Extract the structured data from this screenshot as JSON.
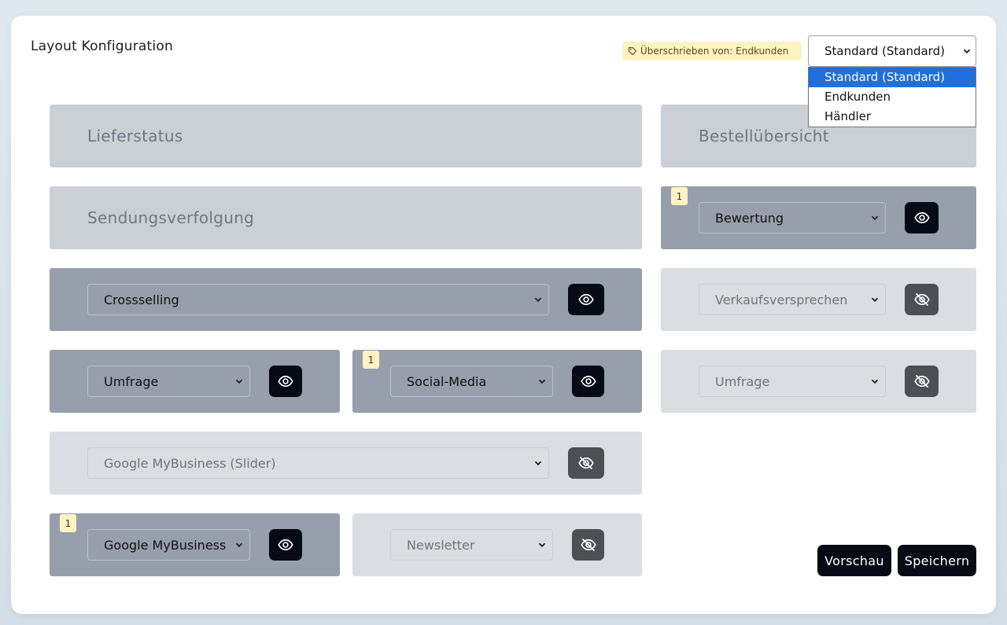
{
  "header": {
    "title": "Layout Konfiguration",
    "override_badge": "Überschrieben von: Endkunden",
    "layout_select": {
      "value": "Standard (Standard)",
      "options": [
        "Standard (Standard)",
        "Endkunden",
        "Händler"
      ]
    }
  },
  "left": {
    "lieferstatus": "Lieferstatus",
    "sendungsverfolgung": "Sendungsverfolgung",
    "crossselling": "Crossselling",
    "umfrage": "Umfrage",
    "social_media": "Social-Media",
    "social_media_count": "1",
    "google_slider": "Google MyBusiness (Slider)",
    "google_mybusiness": "Google MyBusiness",
    "google_mybusiness_count": "1",
    "newsletter": "Newsletter"
  },
  "right": {
    "bestelluebersicht": "Bestellübersicht",
    "bewertung": "Bewertung",
    "bewertung_count": "1",
    "verkaufsversprechen": "Verkaufsversprechen",
    "umfrage": "Umfrage"
  },
  "actions": {
    "preview": "Vorschau",
    "save": "Speichern"
  }
}
